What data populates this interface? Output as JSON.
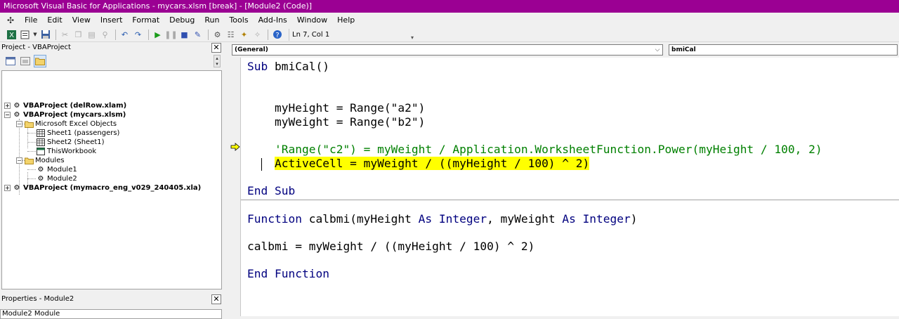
{
  "window": {
    "title": "Microsoft Visual Basic for Applications - mycars.xlsm [break] - [Module2 (Code)]"
  },
  "menu": {
    "items": [
      "File",
      "Edit",
      "View",
      "Insert",
      "Format",
      "Debug",
      "Run",
      "Tools",
      "Add-Ins",
      "Window",
      "Help"
    ]
  },
  "toolbar": {
    "position": "Ln 7, Col 1"
  },
  "project": {
    "title": "Project - VBAProject",
    "close": "✕",
    "tree": [
      {
        "label": "VBAProject (delRow.xlam)"
      },
      {
        "label": "VBAProject (mycars.xlsm)"
      },
      {
        "label": "Microsoft Excel Objects"
      },
      {
        "label": "Sheet1 (passengers)"
      },
      {
        "label": "Sheet2 (Sheet1)"
      },
      {
        "label": "ThisWorkbook"
      },
      {
        "label": "Modules"
      },
      {
        "label": "Module1"
      },
      {
        "label": "Module2"
      },
      {
        "label": "VBAProject (mymacro_eng_v029_240405.xla)"
      }
    ]
  },
  "properties": {
    "title": "Properties - Module2",
    "close": "✕",
    "combo": "Module2 Module"
  },
  "code": {
    "object_combo": "(General)",
    "proc_combo": "bmiCal",
    "lines": {
      "l1_kw": "Sub",
      "l1_rest": " bmiCal()",
      "l3": "    myHeight = Range(\"a2\")",
      "l4": "    myWeight = Range(\"b2\")",
      "l6": "    'Range(\"c2\") = myWeight / Application.WorksheetFunction.Power(myHeight / 100, 2)",
      "l7_indent": "    ",
      "l7_hl": "ActiveCell = myWeight / ((myHeight / 100) ^ 2)",
      "l9": "End Sub",
      "l11_kw1": "Function",
      "l11_mid1": " calbmi(myHeight ",
      "l11_kw2": "As Integer",
      "l11_mid2": ", myWeight ",
      "l11_kw3": "As Integer",
      "l11_end": ")",
      "l13": "calbmi = myWeight / ((myHeight / 100) ^ 2)",
      "l15": "End Function"
    }
  },
  "colors": {
    "titlebar": "#9b0093",
    "keyword": "#00007f",
    "comment": "#008000",
    "highlight": "#ffff00"
  }
}
